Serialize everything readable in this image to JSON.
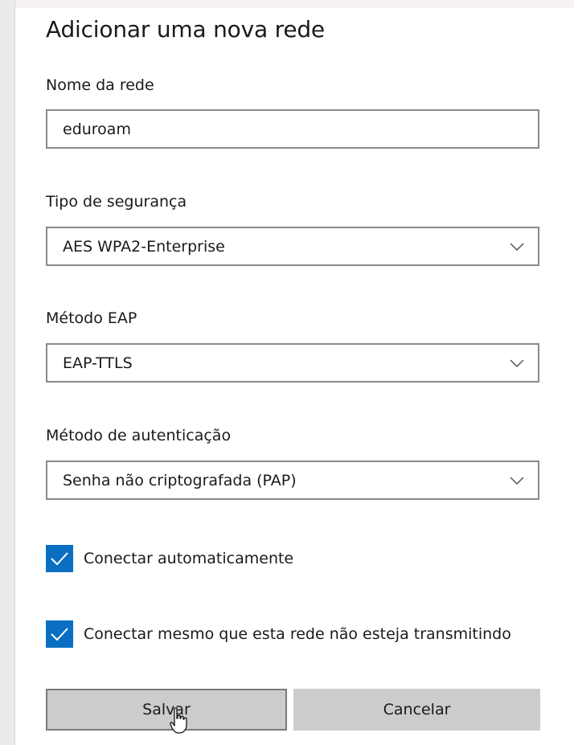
{
  "dialog": {
    "title": "Adicionar uma nova rede",
    "network_name": {
      "label": "Nome da rede",
      "value": "eduroam"
    },
    "security_type": {
      "label": "Tipo de segurança",
      "selected": "AES WPA2-Enterprise"
    },
    "eap_method": {
      "label": "Método EAP",
      "selected": "EAP-TTLS"
    },
    "auth_method": {
      "label": "Método de autenticação",
      "selected": "Senha não criptografada (PAP)"
    },
    "checkboxes": [
      {
        "label": "Conectar automaticamente",
        "checked": true
      },
      {
        "label": "Conectar mesmo que esta rede não esteja transmitindo",
        "checked": true
      }
    ],
    "buttons": {
      "save": "Salvar",
      "cancel": "Cancelar"
    }
  },
  "colors": {
    "accent": "#0a6fc2",
    "button_bg": "#cccccc",
    "field_border": "#8a8a8a"
  },
  "icons": [
    "chevron-down-icon",
    "checkmark-icon",
    "mouse-cursor-icon"
  ]
}
